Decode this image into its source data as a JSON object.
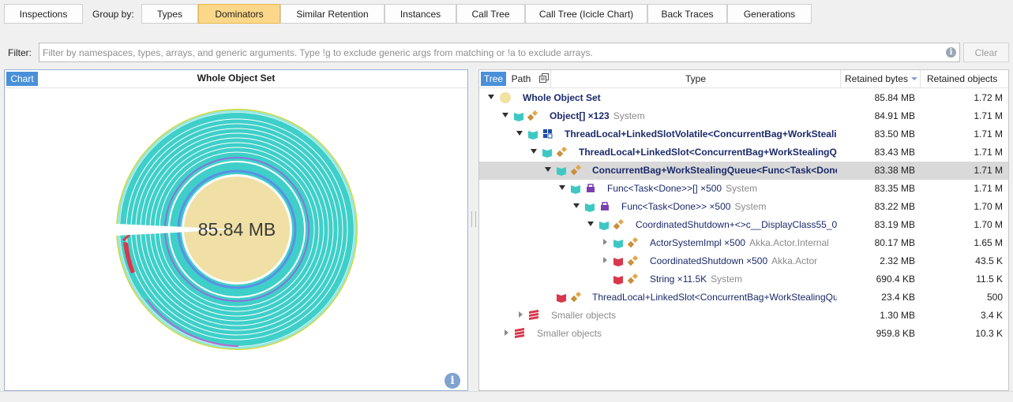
{
  "toolbar": {
    "inspections": "Inspections",
    "group_by": "Group by:",
    "tabs": [
      "Types",
      "Dominators",
      "Similar Retention",
      "Instances",
      "Call Tree",
      "Call Tree (Icicle Chart)",
      "Back Traces",
      "Generations"
    ],
    "active_tab": "Dominators"
  },
  "filter": {
    "label": "Filter:",
    "placeholder": "Filter by namespaces, types, arrays, and generic arguments. Type !g to exclude generic args from matching or !a to exclude arrays.",
    "value": "",
    "clear_label": "Clear"
  },
  "chart_panel": {
    "tab": "Chart",
    "title": "Whole Object Set",
    "center_value": "85.84 MB"
  },
  "tree_panel": {
    "tabs": [
      "Tree",
      "Path"
    ],
    "columns": {
      "type": "Type",
      "retained_bytes": "Retained bytes",
      "retained_objects": "Retained objects"
    },
    "rows": [
      {
        "name": "Whole Object Set",
        "ns": "",
        "bytes": "85.84 MB",
        "objects": "1.72 M"
      },
      {
        "name": "Object[] ×123",
        "ns": "System",
        "bytes": "84.91 MB",
        "objects": "1.71 M"
      },
      {
        "name": "ThreadLocal+LinkedSlotVolatile<ConcurrentBag+WorkStealin",
        "ns": "",
        "bytes": "83.50 MB",
        "objects": "1.71 M"
      },
      {
        "name": "ThreadLocal+LinkedSlot<ConcurrentBag+WorkStealingQu",
        "ns": "",
        "bytes": "83.43 MB",
        "objects": "1.71 M"
      },
      {
        "name": "ConcurrentBag+WorkStealingQueue<Func<Task<Done",
        "ns": "",
        "bytes": "83.38 MB",
        "objects": "1.71 M"
      },
      {
        "name": "Func<Task<Done>>[] ×500",
        "ns": "System",
        "bytes": "83.35 MB",
        "objects": "1.71 M"
      },
      {
        "name": "Func<Task<Done>> ×500",
        "ns": "System",
        "bytes": "83.22 MB",
        "objects": "1.70 M"
      },
      {
        "name": "CoordinatedShutdown+<>c__DisplayClass55_0 :",
        "ns": "",
        "bytes": "83.19 MB",
        "objects": "1.70 M"
      },
      {
        "name": "ActorSystemImpl ×500",
        "ns": "Akka.Actor.Internal",
        "bytes": "80.17 MB",
        "objects": "1.65 M"
      },
      {
        "name": "CoordinatedShutdown ×500",
        "ns": "Akka.Actor",
        "bytes": "2.32 MB",
        "objects": "43.5 K"
      },
      {
        "name": "String ×11.5K",
        "ns": "System",
        "bytes": "690.4 KB",
        "objects": "11.5 K"
      },
      {
        "name": "ThreadLocal+LinkedSlot<ConcurrentBag+WorkStealingQu",
        "ns": "",
        "bytes": "23.4 KB",
        "objects": "500"
      },
      {
        "name": "Smaller objects",
        "ns": "",
        "bytes": "1.30 MB",
        "objects": "3.4 K"
      },
      {
        "name": "Smaller objects",
        "ns": "",
        "bytes": "959.8 KB",
        "objects": "10.3 K"
      }
    ]
  },
  "colors": {
    "accent": "#4a90d9",
    "teal": "#3ec8c4",
    "center": "#f0e0a6",
    "red": "#d8374c",
    "active_tab": "#fbd889"
  }
}
